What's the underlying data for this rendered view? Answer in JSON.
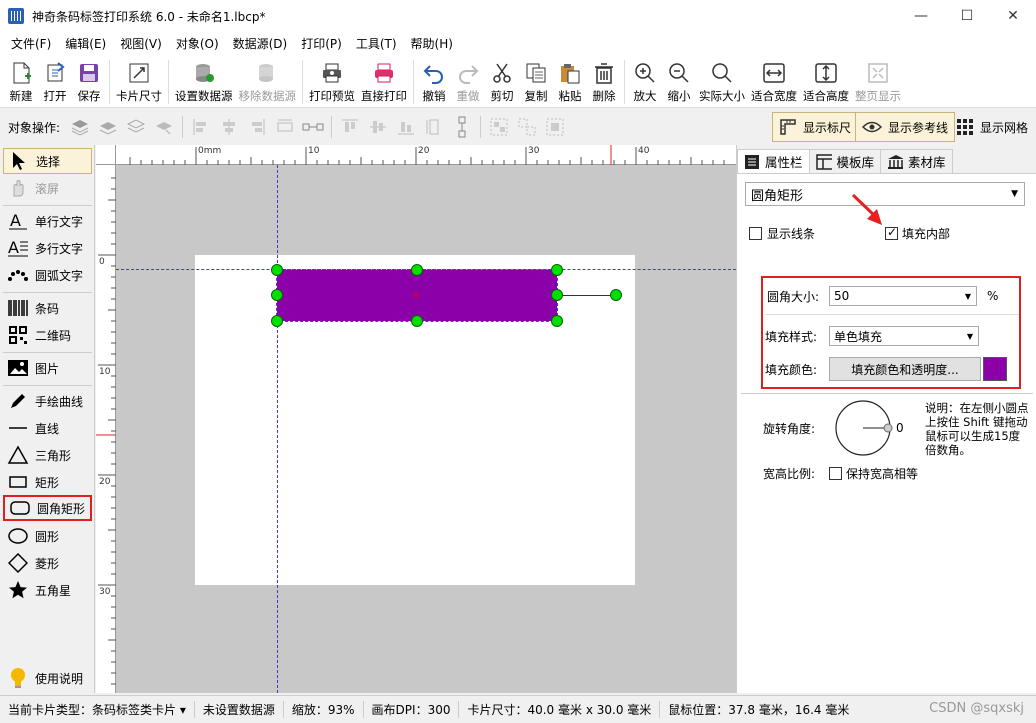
{
  "window": {
    "title": "神奇条码标签打印系统 6.0 - 未命名1.lbcp*",
    "minimize": "—",
    "maximize": "☐",
    "close": "✕"
  },
  "menu": [
    "文件(F)",
    "编辑(E)",
    "视图(V)",
    "对象(O)",
    "数据源(D)",
    "打印(P)",
    "工具(T)",
    "帮助(H)"
  ],
  "toolbar": {
    "new": "新建",
    "open": "打开",
    "save": "保存",
    "card_size": "卡片尺寸",
    "set_datasource": "设置数据源",
    "remove_datasource": "移除数据源",
    "print_preview": "打印预览",
    "direct_print": "直接打印",
    "undo": "撤销",
    "redo": "重做",
    "cut": "剪切",
    "copy": "复制",
    "paste": "粘贴",
    "delete": "删除",
    "zoom_in": "放大",
    "zoom_out": "缩小",
    "actual_size": "实际大小",
    "fit_width": "适合宽度",
    "fit_height": "适合高度",
    "full_page": "整页显示"
  },
  "opsbar": {
    "label": "对象操作:",
    "show_ruler": "显示标尺",
    "show_guides": "显示参考线",
    "show_grid": "显示网格"
  },
  "left_tools": {
    "select": "选择",
    "scroll": "滚屏",
    "single_text": "单行文字",
    "multi_text": "多行文字",
    "arc_text": "圆弧文字",
    "barcode": "条码",
    "qrcode": "二维码",
    "image": "图片",
    "freehand": "手绘曲线",
    "line": "直线",
    "triangle": "三角形",
    "rectangle": "矩形",
    "rounded_rect": "圆角矩形",
    "ellipse": "圆形",
    "diamond": "菱形",
    "star": "五角星",
    "help": "使用说明"
  },
  "ruler": {
    "top": [
      "0mm",
      "10",
      "20",
      "30",
      "40"
    ],
    "left": [
      "0",
      "10",
      "20",
      "30"
    ]
  },
  "right_panel": {
    "tabs": [
      "属性栏",
      "模板库",
      "素材库"
    ],
    "shape_type": "圆角矩形",
    "show_line_label": "显示线条",
    "show_line": false,
    "fill_inside_label": "填充内部",
    "fill_inside": true,
    "corner_label": "圆角大小:",
    "corner_value": "50",
    "corner_unit": "%",
    "fill_style_label": "填充样式:",
    "fill_style_value": "单色填充",
    "fill_color_label": "填充颜色:",
    "fill_color_button": "填充颜色和透明度...",
    "fill_color": "#8b00a8",
    "rotation_label": "旋转角度:",
    "rotation_value": "0",
    "aspect_label": "宽高比例:",
    "keep_aspect_label": "保持宽高相等",
    "keep_aspect": false,
    "note": "说明：在左侧小圆点上按住 Shift 键拖动鼠标可以生成15度倍数角。"
  },
  "statusbar": {
    "card_type": "当前卡片类型：条码标签类卡片 ▾",
    "datasource": "未设置数据源",
    "zoom": "缩放：93%",
    "dpi": "画布DPI：300",
    "card_size": "卡片尺寸：40.0 毫米 x 30.0 毫米",
    "mouse_pos": "鼠标位置：37.8 毫米，16.4 毫米",
    "watermark": "CSDN @sqxskj"
  },
  "colors": {
    "accent": "#8b00a8",
    "handle": "#00e000",
    "highlight": "#e02020",
    "guide": "#3b3bdc"
  }
}
